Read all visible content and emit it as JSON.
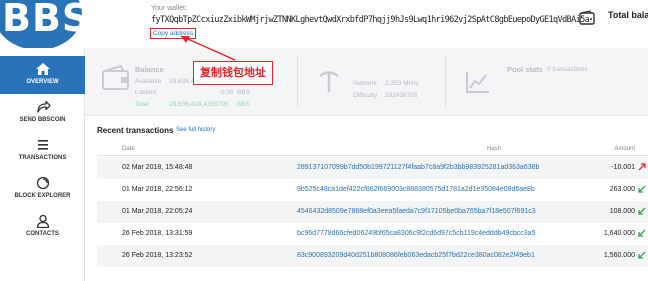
{
  "logo": {
    "text": "BBS"
  },
  "sidebar": {
    "items": [
      {
        "label": "OVERVIEW",
        "icon": "home-icon",
        "active": true
      },
      {
        "label": "SEND BBSCOIN",
        "icon": "send-icon",
        "active": false
      },
      {
        "label": "TRANSACTIONS",
        "icon": "list-icon",
        "active": false
      },
      {
        "label": "BLOCK EXPLORER",
        "icon": "explorer-icon",
        "active": false
      },
      {
        "label": "CONTACTS",
        "icon": "user-icon",
        "active": false
      }
    ]
  },
  "header": {
    "wallet_label": "Your wallet:",
    "wallet_address": "fyTXQqbTpZCcxiuzZxibkWMjrjwZTNNKLghevtQwdXrxbfdP7hqjj9hJs9Lwq1hri962vj2SpAtC8gbEuepoDyGE1qVdBAi5a",
    "copy_label": "Copy address",
    "total_balance_label": "Total balar"
  },
  "annotation": {
    "text": "复制钱包地址",
    "color": "#e2262b"
  },
  "stats": {
    "balance": {
      "title": "Balance",
      "available_label": "Available",
      "available_value": "29,636,418,4356795",
      "locked_label": "Locked",
      "locked_value": "0.00",
      "locked_unit": "BBS",
      "total_label": "Total",
      "total_value": "29,636,418,4356795",
      "total_unit": "BBS"
    },
    "network": {
      "network_label": "Network",
      "network_value": "2.353 MH/s",
      "difficulty_label": "Difficulty",
      "difficulty_value": "282438705"
    },
    "pool": {
      "title": "Pool stats",
      "value": "0 transactions"
    }
  },
  "transactions": {
    "title": "Recent transactions",
    "history_link": "See full history",
    "columns": {
      "date": "Date",
      "hash": "Hash",
      "amount": "Amount"
    },
    "rows": [
      {
        "date": "02 Mar 2018, 15:48:48",
        "hash": "289137107099b7dd50b199721127f4faab7c8a9f2b3bb983925281ad363a638b",
        "amount": "-10.001",
        "direction": "out"
      },
      {
        "date": "01 Mar 2018, 22:56:12",
        "hash": "9b525c48ca1def422cf862f669003c888380575d1781a2d1e35084e08d6ae8b",
        "amount": "263.000",
        "direction": "in"
      },
      {
        "date": "01 Mar 2018, 22:05:24",
        "hash": "4546432d8509e7868ef0a3eea5faeda7c9f17105be0ba765ba7f18e507f691c3",
        "amount": "108.000",
        "direction": "in"
      },
      {
        "date": "26 Feb 2018, 13:31:59",
        "hash": "bc96d7778d66cfed06249bf65ca8306c9f2cd6d97c5cb119c4edddb49cbcc3a5",
        "amount": "1,640.000",
        "direction": "in"
      },
      {
        "date": "26 Feb 2018, 13:23:52",
        "hash": "83c900893209d40d251b808086feb063edacb25f7bd22ce380ac082e2f49eb1",
        "amount": "1,560.000",
        "direction": "in"
      }
    ]
  },
  "colors": {
    "accent": "#2a73b8",
    "annotation": "#e2262b",
    "in": "#2fa84f",
    "out": "#e2262b"
  }
}
